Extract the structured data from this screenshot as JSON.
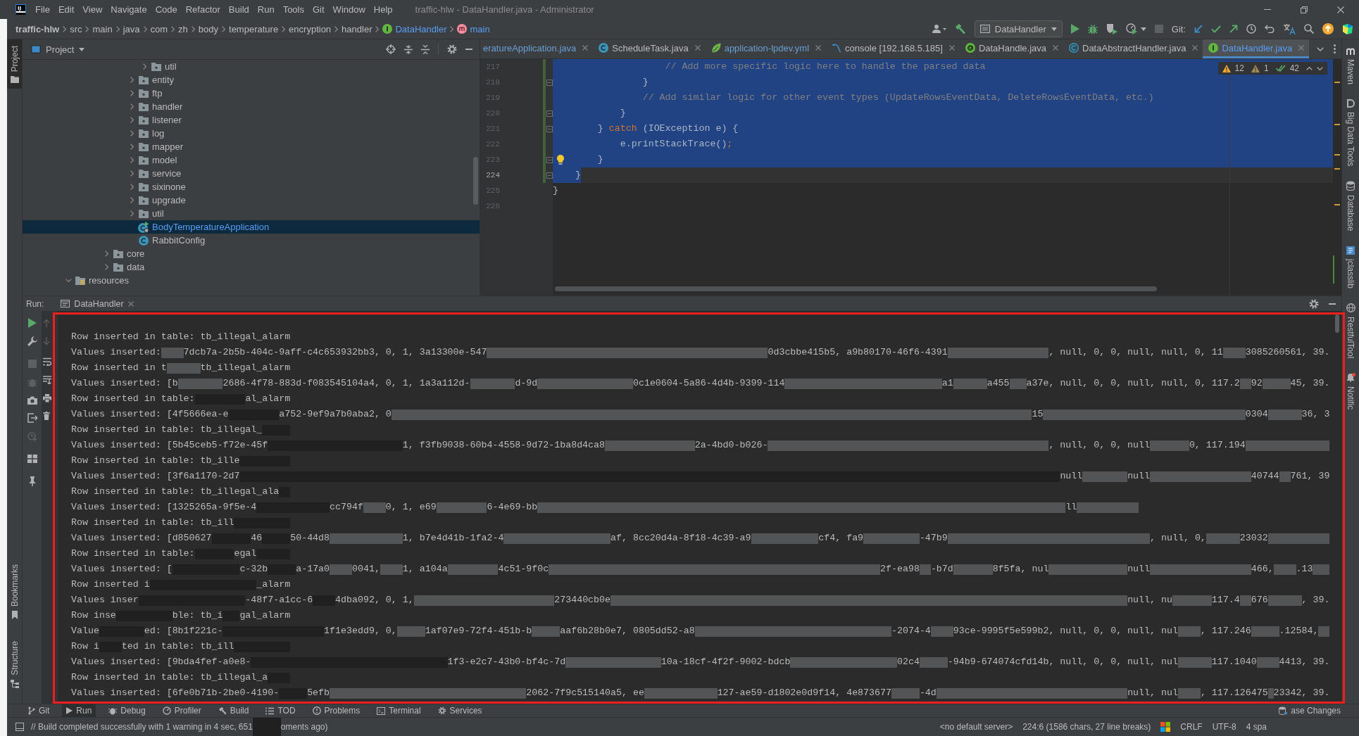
{
  "window": {
    "logo": "IJ",
    "menu": [
      "File",
      "Edit",
      "View",
      "Navigate",
      "Code",
      "Refactor",
      "Build",
      "Run",
      "Tools",
      "Git",
      "Window",
      "Help"
    ],
    "title": "traffic-hlw - DataHandler.java - Administrator"
  },
  "navbar": {
    "breadcrumbs": [
      {
        "label": "traffic-hlw",
        "kind": "project"
      },
      {
        "label": "src",
        "kind": "dir"
      },
      {
        "label": "main",
        "kind": "dir"
      },
      {
        "label": "java",
        "kind": "dir"
      },
      {
        "label": "com",
        "kind": "dir"
      },
      {
        "label": "zh",
        "kind": "dir"
      },
      {
        "label": "body",
        "kind": "dir"
      },
      {
        "label": "temperature",
        "kind": "dir"
      },
      {
        "label": "encryption",
        "kind": "dir"
      },
      {
        "label": "handler",
        "kind": "dir"
      },
      {
        "label": "DataHandler",
        "kind": "interface"
      },
      {
        "label": "main",
        "kind": "method"
      }
    ],
    "run_config": "DataHandler",
    "stop_enabled": false,
    "vcs_label": "Git:"
  },
  "left_strip": {
    "top": [
      {
        "label": "Project",
        "selected": true
      }
    ],
    "bottom": [
      {
        "label": "Bookmarks",
        "selected": false
      },
      {
        "label": "Structure",
        "selected": false
      }
    ]
  },
  "right_strip": [
    {
      "label": "Maven",
      "kind": "maven",
      "badge": false
    },
    {
      "label": "Big Data Tools",
      "kind": "bigdata",
      "badge": false
    },
    {
      "label": "Database",
      "kind": "database",
      "badge": false
    },
    {
      "label": "jclasslib",
      "kind": "jclasslib",
      "badge": false
    },
    {
      "label": "RestfulTool",
      "kind": "restful",
      "badge": false
    },
    {
      "label": "Notific",
      "kind": "notifications",
      "badge": true
    }
  ],
  "project": {
    "title": "Project",
    "tree": [
      {
        "children": [
          {
            "children": [
              {
                "children": [
                  {
                    "children": [
                      {
                        "children": [
                          {
                            "children": [
                              {
                                "label": "util",
                                "kind": "package",
                                "expanded": false,
                                "selected": false
                              }
                            ]
                          },
                          {
                            "label": "entity",
                            "kind": "package",
                            "expanded": false,
                            "selected": false
                          },
                          {
                            "label": "ftp",
                            "kind": "package",
                            "expanded": false,
                            "selected": false
                          },
                          {
                            "label": "handler",
                            "kind": "package",
                            "expanded": false,
                            "selected": false
                          },
                          {
                            "label": "listener",
                            "kind": "package",
                            "expanded": false,
                            "selected": false
                          },
                          {
                            "label": "log",
                            "kind": "package",
                            "expanded": false,
                            "selected": false
                          },
                          {
                            "label": "mapper",
                            "kind": "package",
                            "expanded": false,
                            "selected": false
                          },
                          {
                            "label": "model",
                            "kind": "package",
                            "expanded": false,
                            "selected": false
                          },
                          {
                            "label": "service",
                            "kind": "package",
                            "expanded": false,
                            "selected": false
                          },
                          {
                            "label": "sixinone",
                            "kind": "package",
                            "expanded": false,
                            "selected": false
                          },
                          {
                            "label": "upgrade",
                            "kind": "package",
                            "expanded": false,
                            "selected": false
                          },
                          {
                            "label": "util",
                            "kind": "package",
                            "expanded": false,
                            "selected": false
                          },
                          {
                            "label": "BodyTemperatureApplication",
                            "kind": "app",
                            "selected": true
                          },
                          {
                            "label": "RabbitConfig",
                            "kind": "class",
                            "selected": false
                          }
                        ]
                      }
                    ]
                  },
                  {
                    "label": "core",
                    "kind": "package",
                    "expanded": false,
                    "selected": false
                  },
                  {
                    "label": "data",
                    "kind": "package",
                    "expanded": false,
                    "selected": false
                  }
                ]
              }
            ]
          }
        ]
      },
      {
        "label": "resources",
        "kind": "resources",
        "expanded": true,
        "selected": false
      }
    ]
  },
  "editor": {
    "tabs": [
      {
        "label": "eratureApplication.java",
        "kind": "cut",
        "modified": true,
        "selected": false
      },
      {
        "label": "ScheduleTask.java",
        "kind": "class",
        "modified": false,
        "selected": false
      },
      {
        "label": "application-lpdev.yml",
        "kind": "yaml",
        "modified": true,
        "selected": false
      },
      {
        "label": "console [192.168.5.185]",
        "kind": "console",
        "modified": false,
        "selected": false
      },
      {
        "label": "DataHandle.java",
        "kind": "annotation",
        "modified": false,
        "selected": false
      },
      {
        "label": "DataAbstractHandler.java",
        "kind": "abstract",
        "modified": false,
        "selected": false
      },
      {
        "label": "DataHandler.java",
        "kind": "interface",
        "modified": true,
        "selected": true
      }
    ],
    "inspections": {
      "warnings": "12",
      "weak_warnings": "1",
      "passed": "42"
    },
    "lines": [
      {
        "number": "217",
        "selected": true,
        "caret": false,
        "fold": false,
        "changed": true,
        "bulb": false,
        "tokens": [
          {
            "kind": "comment",
            "text": "                    // Add more specific logic here to handle the parsed data"
          }
        ]
      },
      {
        "number": "218",
        "selected": true,
        "caret": false,
        "fold": true,
        "changed": true,
        "bulb": false,
        "tokens": [
          {
            "kind": "code",
            "text": "                }"
          }
        ]
      },
      {
        "number": "219",
        "selected": true,
        "caret": false,
        "fold": false,
        "changed": true,
        "bulb": false,
        "tokens": [
          {
            "kind": "comment",
            "text": "                // Add similar logic for other event types (UpdateRowsEventData, DeleteRowsEventData, etc.)"
          }
        ]
      },
      {
        "number": "220",
        "selected": true,
        "caret": false,
        "fold": true,
        "changed": true,
        "bulb": false,
        "tokens": [
          {
            "kind": "code",
            "text": "            }"
          }
        ]
      },
      {
        "number": "221",
        "selected": true,
        "caret": false,
        "fold": true,
        "changed": true,
        "bulb": false,
        "tokens": [
          {
            "kind": "code",
            "text": "        } "
          },
          {
            "kind": "keyword",
            "text": "catch"
          },
          {
            "kind": "code",
            "text": " (IOException e) {"
          }
        ]
      },
      {
        "number": "222",
        "selected": true,
        "caret": false,
        "fold": false,
        "changed": true,
        "bulb": false,
        "tokens": [
          {
            "kind": "code",
            "text": "            e.printStackTrace()"
          },
          {
            "kind": "keyword",
            "text": ";"
          }
        ]
      },
      {
        "number": "223",
        "selected": true,
        "caret": false,
        "fold": true,
        "changed": true,
        "bulb": true,
        "tokens": [
          {
            "kind": "code",
            "text": "        }"
          }
        ]
      },
      {
        "number": "224",
        "selected": true,
        "caret": true,
        "fold": true,
        "changed": true,
        "bulb": false,
        "tokens": [
          {
            "kind": "code",
            "text": "    }"
          }
        ]
      },
      {
        "number": "225",
        "selected": false,
        "caret": false,
        "fold": false,
        "changed": false,
        "bulb": false,
        "tokens": [
          {
            "kind": "code",
            "text": "}"
          }
        ]
      },
      {
        "number": "226",
        "selected": false,
        "caret": false,
        "fold": false,
        "changed": false,
        "bulb": false
      }
    ]
  },
  "run": {
    "label": "Run:",
    "tab": "DataHandler",
    "stop_enabled": false,
    "prev_next_enabled": false,
    "highlighted": true,
    "lines": [
      {
        "segments": [
          "Row inserted in table: tb_illegal_alarm"
        ]
      },
      {
        "segments": [
          "Values inserted:",
          "7dcb7a-2b5b-404c-9aff-c4c653932bb3, 0, 1, 3a13300e-547",
          "0d3cbbe415b5, a9b80170-46f6-4391",
          ", null, 0, 0, null, null, 0, 11",
          "3085260561, 39."
        ]
      },
      {
        "segments": [
          "Row inserted in t",
          "tb_illegal_alarm"
        ]
      },
      {
        "segments": [
          "Values inserted: [b",
          "2686-4f78-883d-f083545104a4, 0, 1, 1a3a112d-",
          "d-9d",
          "0c1e0604-5a86-4d4b-9399-114",
          "a1",
          "a455",
          "a37e, null, 0, 0, null, null, 0, 117.2",
          "92",
          "45, 39."
        ]
      },
      {
        "segments": [
          "Row inserted in table:",
          "al_alarm"
        ]
      },
      {
        "segments": [
          "Values inserted: [4f5666ea-e",
          "a752-9ef9a7b0aba2, 0",
          "15",
          "0304",
          "36, 3"
        ]
      },
      {
        "segments": [
          "Row inserted in table: tb_illegal_"
        ]
      },
      {
        "segments": [
          "Values inserted: [5b45ceb5-f72e-45f",
          "1, f3fb9038-60b4-4558-9d72-1ba8d4ca8",
          "2a-4bd0-b026-",
          ", null, 0, 0, null",
          "0, 117.194"
        ]
      },
      {
        "segments": [
          "Row inserted in table: tb_ille"
        ]
      },
      {
        "segments": [
          "Values inserted: [3f6a1170-2d7",
          "null",
          "null",
          "40744",
          "761, 39"
        ]
      },
      {
        "segments": [
          "Row inserted in table: tb_illegal_ala"
        ]
      },
      {
        "segments": [
          "Values inserted: [1325265a-9f5e-4",
          "cc794f",
          "0, 1, e69",
          "6-4e69-bb",
          "ll"
        ]
      },
      {
        "segments": [
          "Row inserted in table: tb_ill"
        ]
      },
      {
        "segments": [
          "Values inserted: [d850627",
          "46",
          "50-44d8",
          "1, b7e4d41b-1fa2-4",
          "af, 8cc20d4a-8f18-4c39-a9",
          "cf4, fa9",
          "-47b9",
          ", null, 0,",
          "23032"
        ]
      },
      {
        "segments": [
          "Row inserted in table:",
          "egal"
        ]
      },
      {
        "segments": [
          "Values inserted: [",
          "c-32b",
          "a-17a0",
          "0041,",
          "1, a104a",
          "4c51-9f0c",
          "2f-ea98",
          "-b7d",
          "8f5fa, nul",
          "null",
          "466,",
          ".13"
        ]
      },
      {
        "segments": [
          "Row inserted i",
          "_alarm"
        ]
      },
      {
        "segments": [
          "Values inser",
          "-48f7-a1cc-6",
          "4dba092, 0, 1,",
          "273440cb0e",
          "null, nu",
          "117.4",
          "676",
          ", 39."
        ]
      },
      {
        "segments": [
          "Row inse",
          "ble: tb_i",
          "gal_alarm"
        ]
      },
      {
        "segments": [
          "Value",
          "ed: [8b1f221c-",
          "1f1e3edd9, 0,",
          "1af07e9-72f4-451b-b",
          "aaf6b28b0e7, 0805dd52-a8",
          "-2074-4",
          "93ce-9995f5e599b2, null, 0, 0, null, nul",
          ", 117.246",
          ".12584,"
        ]
      },
      {
        "segments": [
          "Row i",
          "ted in table: tb_ill"
        ]
      },
      {
        "segments": [
          "Values inserted: [9bda4fef-a0e8-",
          "1f3-e2c7-43b0-bf4c-7d",
          "10a-18cf-4f2f-9002-bdcb",
          "02c4",
          "-94b9-674074cfd14b, null, 0, 0, null, nul",
          "117.1040",
          "4413, 39."
        ]
      },
      {
        "segments": [
          "Row inserted in table: tb_illegal_a"
        ]
      },
      {
        "segments": [
          "Values inserted: [6fe0b71b-2be0-4190-",
          "5efb",
          "2062-7f9c515140a5, ee",
          "127-ae59-d1802e0d9f14, 4e873677",
          "-4d",
          "null, nul",
          ", 117.126475",
          "23342, 39."
        ]
      }
    ]
  },
  "tool_windows": {
    "left": [
      {
        "label": "Git",
        "kind": "git",
        "selected": false
      },
      {
        "label": "Run",
        "kind": "run",
        "selected": true
      },
      {
        "label": "Debug",
        "kind": "debug",
        "selected": false
      },
      {
        "label": "Profiler",
        "kind": "profiler",
        "selected": false
      },
      {
        "label": "Build",
        "kind": "build",
        "selected": false
      },
      {
        "label": "TOD",
        "kind": "todo",
        "selected": false
      },
      {
        "label": "Problems",
        "kind": "problems",
        "selected": false
      },
      {
        "label": "Terminal",
        "kind": "terminal",
        "selected": false
      },
      {
        "label": "Services",
        "kind": "services",
        "selected": false
      }
    ],
    "right": [
      {
        "label": "ase Changes",
        "kind": "changes",
        "selected": false
      }
    ]
  },
  "status_bar": {
    "message": [
      "// Build completed successfully with 1 warning in 4 sec, 651",
      "oments ago)"
    ],
    "server": "<no default server>",
    "position": "224:6 (1586 chars, 27 line breaks)",
    "line_separator": "CRLF",
    "encoding": "UTF-8",
    "indent": "4 spa"
  }
}
